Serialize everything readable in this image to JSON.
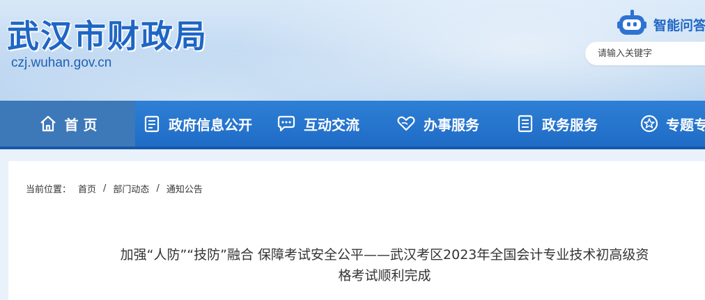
{
  "header": {
    "site_title": "武汉市财政局",
    "site_url": "czj.wuhan.gov.cn",
    "ai_label": "智能问答",
    "search_placeholder": "请输入关键字"
  },
  "nav": {
    "items": [
      {
        "label": "首 页",
        "icon": "home-icon"
      },
      {
        "label": "政府信息公开",
        "icon": "document-icon"
      },
      {
        "label": "互动交流",
        "icon": "chat-icon"
      },
      {
        "label": "办事服务",
        "icon": "heart-hand-icon"
      },
      {
        "label": "政务服务",
        "icon": "service-list-icon"
      },
      {
        "label": "专题专栏",
        "icon": "star-icon"
      }
    ],
    "active_index": 0
  },
  "breadcrumb": {
    "prefix": "当前位置：",
    "items": [
      "首页",
      "部门动态",
      "通知公告"
    ],
    "separator": "/"
  },
  "article": {
    "title_line1": "加强“人防”“技防”融合 保障考试安全公平——武汉考区2023年全国会计专业技术初高级资",
    "title_line2": "格考试顺利完成"
  },
  "colors": {
    "brand_blue": "#1f66c4",
    "nav_bg": "#2e7fd6",
    "nav_active": "#3d78b8"
  }
}
